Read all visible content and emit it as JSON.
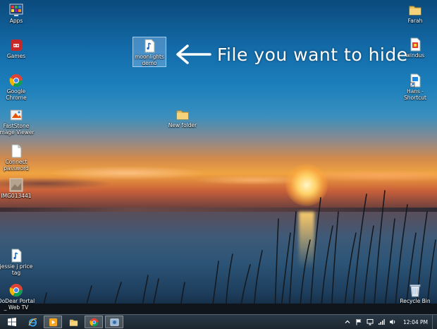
{
  "desktop": {
    "left_icons": [
      {
        "name": "apps",
        "label": "Apps",
        "icon": "apps-icon"
      },
      {
        "name": "games",
        "label": "Games",
        "icon": "games-icon"
      },
      {
        "name": "google-chrome",
        "label": "Google\nChrome",
        "icon": "chrome-icon"
      },
      {
        "name": "faststone",
        "label": "FastStone\nImage Viewer",
        "icon": "faststone-icon"
      },
      {
        "name": "connect-password",
        "label": "Connect\npassword",
        "icon": "document-icon"
      },
      {
        "name": "img013441",
        "label": "IMG013441",
        "icon": "image-thumbnail-icon"
      },
      {
        "name": "jessie-price-tag",
        "label": "jessie j price\ntag",
        "icon": "audio-file-icon"
      },
      {
        "name": "dodear-portal",
        "label": "DoDear Portal\n_ Web TV",
        "icon": "chrome-icon"
      }
    ],
    "right_icons": [
      {
        "name": "farah",
        "label": "Farah",
        "icon": "folder-icon"
      },
      {
        "name": "windus",
        "label": "windus",
        "icon": "installer-icon"
      },
      {
        "name": "hans-shortcut",
        "label": "Hans -\nShortcut",
        "icon": "shortcut-icon"
      },
      {
        "name": "recycle-bin",
        "label": "Recycle Bin",
        "icon": "recycle-bin-icon"
      }
    ],
    "center_icons": [
      {
        "name": "moonlight-demo",
        "label": "moonlights\ndemo",
        "icon": "audio-file-icon",
        "selected": true
      },
      {
        "name": "new-folder",
        "label": "New folder",
        "icon": "folder-icon"
      }
    ]
  },
  "annotation": {
    "text": "File you want to hide",
    "icon": "left-arrow-icon"
  },
  "taskbar": {
    "start_icon": "windows-logo-icon",
    "pinned": [
      {
        "name": "internet-explorer",
        "icon": "ie-icon",
        "active": false
      },
      {
        "name": "media-player",
        "icon": "media-player-icon",
        "active": true
      },
      {
        "name": "file-explorer",
        "icon": "folder-icon",
        "active": false
      },
      {
        "name": "chrome",
        "icon": "chrome-icon",
        "active": true
      },
      {
        "name": "app-window",
        "icon": "app-window-icon",
        "active": true
      }
    ],
    "tray": {
      "icons": [
        "chevron-up-icon",
        "flag-icon",
        "monitor-icon",
        "network-icon",
        "volume-icon"
      ],
      "time": "12:04 PM"
    }
  },
  "colors": {
    "taskbar": "#1b262f",
    "sky_top": "#0b4a7c",
    "sunset": "#f0a440",
    "selection": "#aad2ff"
  }
}
